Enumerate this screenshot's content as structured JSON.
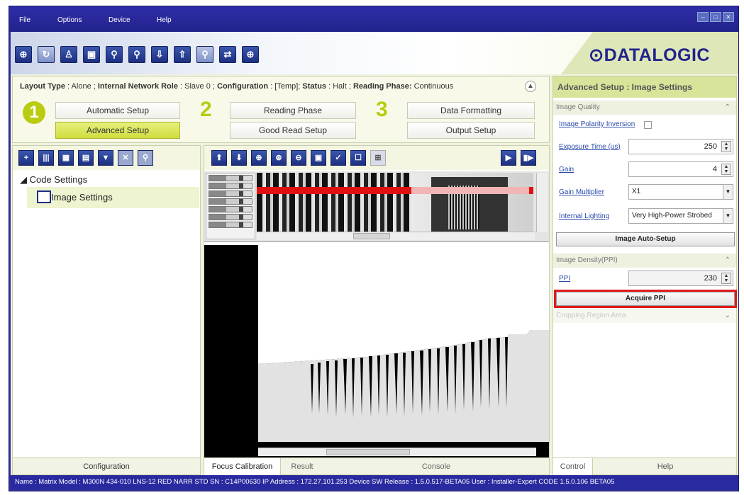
{
  "menu": {
    "items": [
      "File",
      "Options",
      "Device",
      "Help"
    ]
  },
  "window_controls": [
    "–",
    "□",
    "✕"
  ],
  "brand": {
    "logo_text": "⊙DATALOGIC",
    "accent": "#23238c",
    "highlight": "#d7e49a"
  },
  "layout_info": {
    "layout_type_label": "Layout Type",
    "layout_type_value": ": Alone ;",
    "network_role_label": "Internal Network Role",
    "network_role_value": ": Slave 0 ;",
    "configuration_label": "Configuration",
    "configuration_value": ": [Temp];",
    "status_label": "Status",
    "status_value": ": Halt ;",
    "reading_phase_label": "Reading Phase:",
    "reading_phase_value": "Continuous"
  },
  "steps": [
    {
      "number": "1",
      "buttons": [
        "Automatic Setup",
        "Advanced Setup"
      ]
    },
    {
      "number": "2",
      "buttons": [
        "Reading Phase",
        "Good Read Setup"
      ]
    },
    {
      "number": "3",
      "buttons": [
        "Data Formatting",
        "Output Setup"
      ]
    }
  ],
  "tree": {
    "root": "◢ Code Settings",
    "child": "Image Settings",
    "tab": "Configuration"
  },
  "center_tabs": [
    "Focus Calibration",
    "Result",
    "Console"
  ],
  "right_panel": {
    "title": "Advanced Setup : Image Settings",
    "image_quality": {
      "header": "Image Quality",
      "polarity_label": "Image Polarity Inversion",
      "exposure_label": "Exposure Time (us)",
      "exposure_value": "250",
      "gain_label": "Gain",
      "gain_value": "4",
      "gain_multiplier_label": "Gain Multiplier",
      "gain_multiplier_value": "X1",
      "lighting_label": "Internal Lighting",
      "lighting_value": "Very High-Power Strobed",
      "auto_setup_button": "Image Auto-Setup"
    },
    "density": {
      "header": "Image Density(PPI)",
      "ppi_label": "PPI",
      "ppi_value": "230",
      "acquire_button": "Acquire PPI"
    },
    "cropping_header": "Cropping Region Area",
    "tabs": [
      "Control",
      "Help"
    ]
  },
  "status_bar": "Name : Matrix   Model : M300N 434-010 LNS-12 RED NARR STD   SN : C14P00630   IP Address : 172.27.101.253   Device SW Release : 1.5.0.517-BETA05   User : Installer-Expert   CODE 1.5.0.106 BETA05"
}
